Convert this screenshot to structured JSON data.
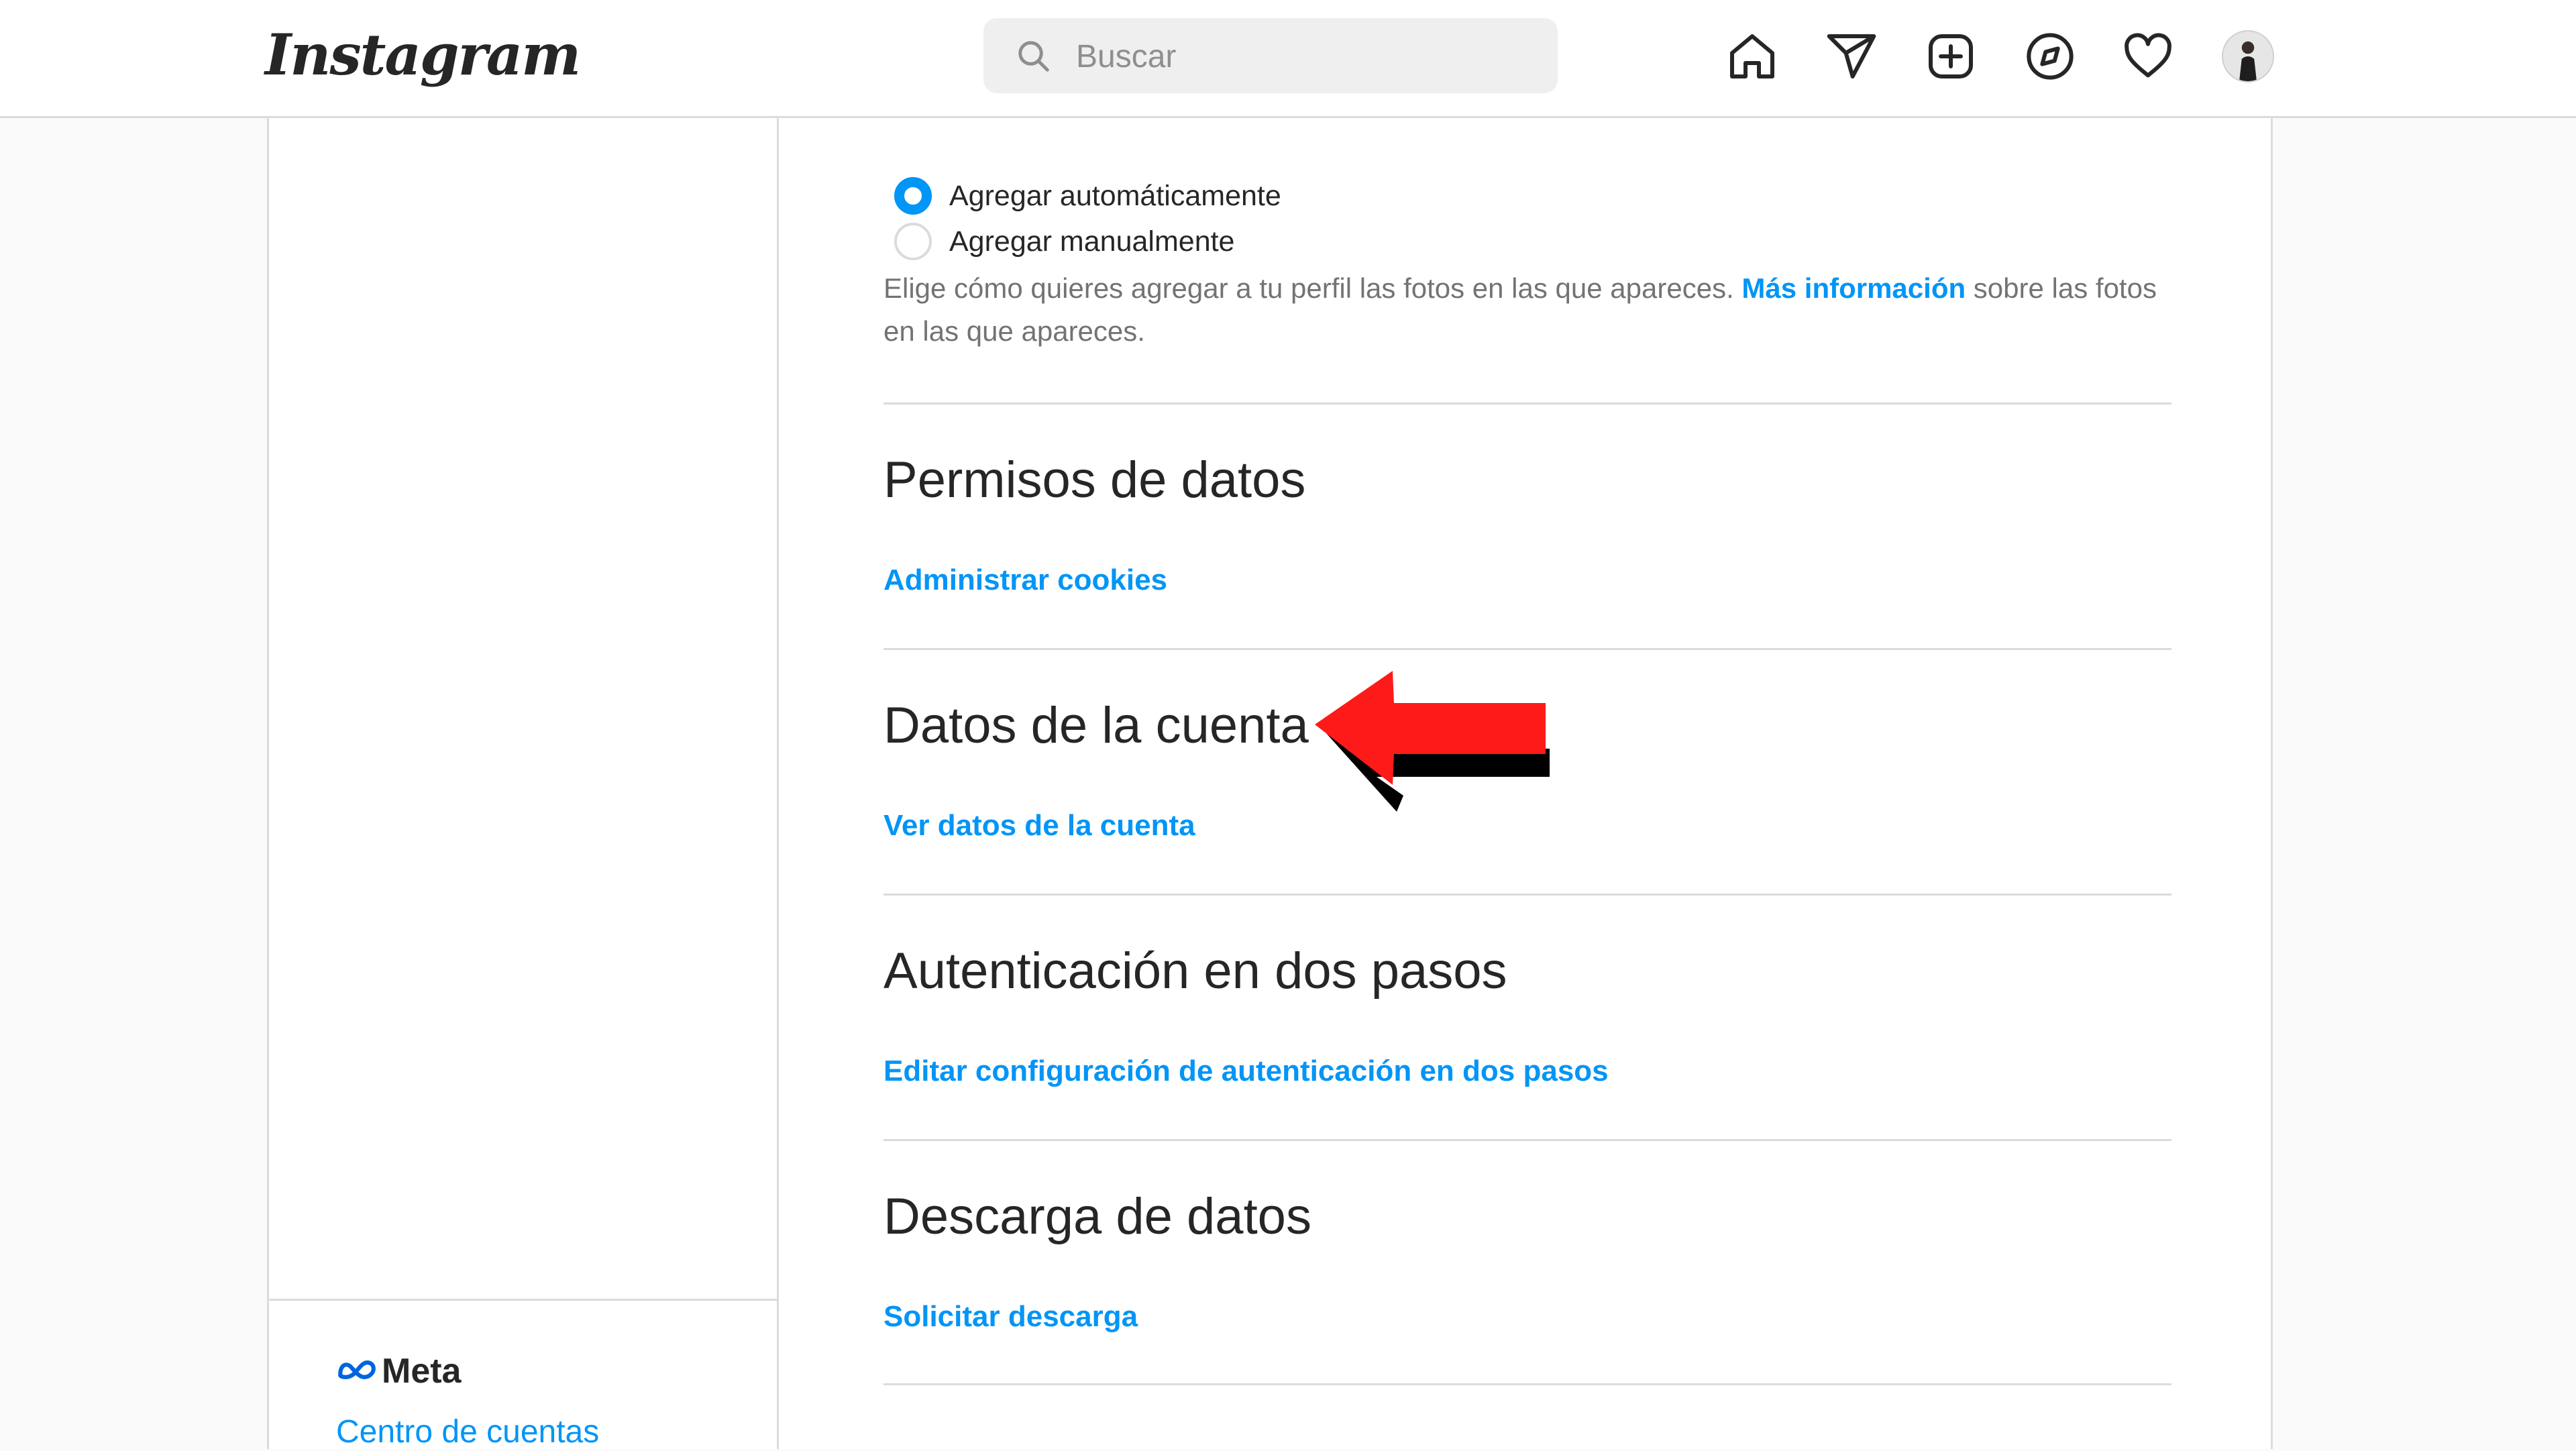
{
  "header": {
    "logo_text": "Instagram",
    "search": {
      "placeholder": "Buscar",
      "icon": "search-icon"
    },
    "nav_icons": [
      "home-icon",
      "direct-message-icon",
      "new-post-icon",
      "explore-icon",
      "activity-heart-icon",
      "profile-avatar"
    ]
  },
  "main": {
    "photos_of_you": {
      "options": [
        {
          "label": "Agregar automáticamente",
          "selected": true
        },
        {
          "label": "Agregar manualmente",
          "selected": false
        }
      ],
      "help_before": "Elige cómo quieres agregar a tu perfil las fotos en las que apareces. ",
      "help_link": "Más información",
      "help_after": " sobre las fotos en las que apareces."
    },
    "sections": [
      {
        "title": "Permisos de datos",
        "link": "Administrar cookies"
      },
      {
        "title": "Datos de la cuenta",
        "link": "Ver datos de la cuenta"
      },
      {
        "title": "Autenticación en dos pasos",
        "link": "Editar configuración de autenticación en dos pasos"
      },
      {
        "title": "Descarga de datos",
        "link": "Solicitar descarga"
      }
    ],
    "annotation_arrow": {
      "color": "#ff1a1a",
      "points_to": "Datos de la cuenta"
    }
  },
  "sidebar": {
    "meta_logo_text": "Meta",
    "accounts_center_link": "Centro de cuentas"
  },
  "colors": {
    "accent": "#0095f6",
    "border": "#dbdbdb",
    "background": "#fafafa"
  }
}
